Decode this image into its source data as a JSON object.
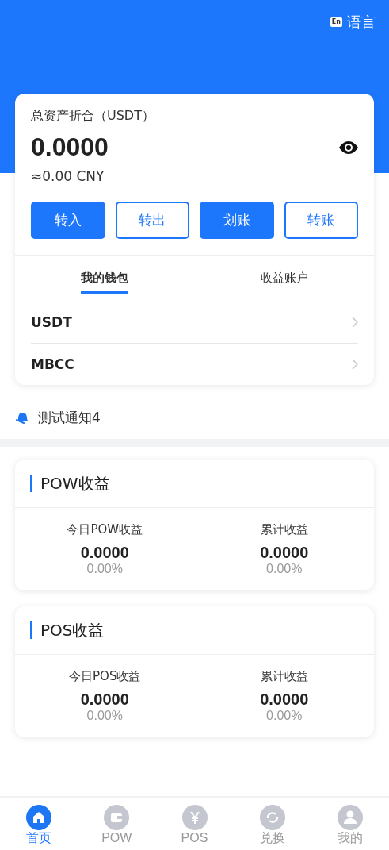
{
  "header": {
    "language_badge": "En",
    "language": "语言"
  },
  "asset_card": {
    "label": "总资产折合（USDT）",
    "amount": "0.0000",
    "cny": "≈0.00 CNY",
    "buttons": [
      {
        "label": "转入",
        "kind": "filled"
      },
      {
        "label": "转出",
        "kind": "outline"
      },
      {
        "label": "划账",
        "kind": "filled"
      },
      {
        "label": "转账",
        "kind": "outline"
      }
    ],
    "tabs": [
      {
        "label": "我的钱包",
        "selected": true
      },
      {
        "label": "收益账户",
        "selected": false
      }
    ],
    "wallets": [
      {
        "name": "USDT"
      },
      {
        "name": "MBCC"
      }
    ]
  },
  "notice": {
    "text": "测试通知4"
  },
  "earnings": [
    {
      "title": "POW收益",
      "stats": [
        {
          "label": "今日POW收益",
          "value": "0.0000",
          "percent": "0.00%"
        },
        {
          "label": "累计收益",
          "value": "0.0000",
          "percent": "0.00%"
        }
      ]
    },
    {
      "title": "POS收益",
      "stats": [
        {
          "label": "今日POS收益",
          "value": "0.0000",
          "percent": "0.00%"
        },
        {
          "label": "累计收益",
          "value": "0.0000",
          "percent": "0.00%"
        }
      ]
    }
  ],
  "bottom_nav": [
    {
      "label": "首页",
      "kind": "home",
      "selected": true
    },
    {
      "label": "POW",
      "kind": "wallet",
      "selected": false
    },
    {
      "label": "POS",
      "kind": "yen",
      "selected": false
    },
    {
      "label": "兑换",
      "kind": "exchange",
      "selected": false
    },
    {
      "label": "我的",
      "kind": "user",
      "selected": false
    }
  ]
}
